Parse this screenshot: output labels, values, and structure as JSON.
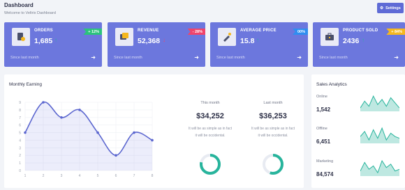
{
  "header": {
    "title": "Dashboard",
    "subtitle": "Welcome to Veltrix Dashboard",
    "settings_label": "Settings"
  },
  "colors": {
    "accent": "#6c77dd",
    "teal": "#27b49c",
    "green": "#2bc37c",
    "red": "#f0446b",
    "blue": "#2f8ef0",
    "yellow": "#f5b71e"
  },
  "cards": [
    {
      "label": "ORDERS",
      "value": "1,685",
      "arrow": "↑",
      "arrow_color": "#27b49c",
      "badge": "+ 12%",
      "badge_color": "#2bc37c",
      "footer": "Since last month",
      "icon": "orders-icon"
    },
    {
      "label": "REVENUE",
      "value": "52,368",
      "arrow": "↓",
      "arrow_color": "#f0446b",
      "badge": "- 28%",
      "badge_color": "#f0446b",
      "footer": "Since last month",
      "icon": "revenue-icon"
    },
    {
      "label": "AVERAGE PRICE",
      "value": "15.8",
      "arrow": "↑",
      "arrow_color": "#27b49c",
      "badge": "00%",
      "badge_color": "#2f8ef0",
      "footer": "Since last month",
      "icon": "price-tag-icon"
    },
    {
      "label": "PRODUCT SOLD",
      "value": "2436",
      "arrow": "↑",
      "arrow_color": "#27b49c",
      "badge": "+ 84%",
      "badge_color": "#f5b71e",
      "footer": "Since last month",
      "icon": "briefcase-icon"
    }
  ],
  "monthly": {
    "title": "Monthly Earning",
    "this_month": {
      "label": "This month",
      "value": "$34,252",
      "desc_1": "It will be as simple as in fact",
      "desc_2": "it will be occidental.",
      "progress": 0.78
    },
    "last_month": {
      "label": "Last month",
      "value": "$36,253",
      "desc_1": "It will be as simple as in fact",
      "desc_2": "it will be occidental.",
      "progress": 0.55
    }
  },
  "chart_data": {
    "type": "area",
    "x": [
      1,
      2,
      3,
      4,
      5,
      6,
      7,
      8
    ],
    "y_ticks": [
      0,
      1,
      2,
      3,
      4,
      5,
      6,
      7,
      8,
      9
    ],
    "series": [
      {
        "values": [
          5,
          9,
          7,
          8,
          5,
          2,
          5,
          4
        ]
      }
    ],
    "ylim": [
      0,
      9
    ],
    "xlim": [
      1,
      8
    ],
    "grid": true
  },
  "sales": {
    "title": "Sales Analytics",
    "rows": [
      {
        "name": "Online",
        "value": "1,542",
        "spark": [
          2,
          6,
          3,
          9,
          4,
          7,
          3,
          8,
          5,
          2
        ]
      },
      {
        "name": "Offline",
        "value": "6,451",
        "spark": [
          4,
          7,
          2,
          8,
          3,
          9,
          2,
          6,
          4,
          3
        ]
      },
      {
        "name": "Marketing",
        "value": "84,574",
        "spark": [
          3,
          8,
          4,
          6,
          2,
          9,
          5,
          7,
          3,
          4
        ]
      }
    ]
  }
}
